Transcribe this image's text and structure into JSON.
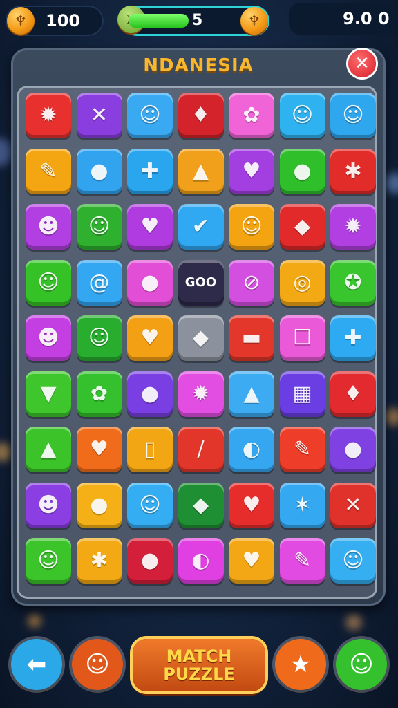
{
  "hud": {
    "coins": "100",
    "level": "5",
    "level_progress": 0.45,
    "timer": "9.0 0"
  },
  "panel": {
    "title": "NDANESIA",
    "close_glyph": "✕"
  },
  "board": {
    "tiles": [
      [
        {
          "c": "#e8312f",
          "g": "✹"
        },
        {
          "c": "#8a3ee0",
          "g": "✕"
        },
        {
          "c": "#39a9f2",
          "g": "☺"
        },
        {
          "c": "#d4232a",
          "g": "♦"
        },
        {
          "c": "#f064d8",
          "g": "✿"
        },
        {
          "c": "#2fb3f0",
          "g": "☺"
        },
        {
          "c": "#2fa7ef",
          "g": "☺"
        }
      ],
      [
        {
          "c": "#f4a512",
          "g": "✎"
        },
        {
          "c": "#32a3ef",
          "g": "●"
        },
        {
          "c": "#2aa6ef",
          "g": "✚"
        },
        {
          "c": "#f0a01a",
          "g": "▲"
        },
        {
          "c": "#a33ee0",
          "g": "♥"
        },
        {
          "c": "#2fbf2b",
          "g": "●"
        },
        {
          "c": "#e22c2a",
          "g": "✱"
        }
      ],
      [
        {
          "c": "#b23fe2",
          "g": "☻"
        },
        {
          "c": "#2fb02f",
          "g": "☺"
        },
        {
          "c": "#b03be0",
          "g": "♥"
        },
        {
          "c": "#30a8f2",
          "g": "✔"
        },
        {
          "c": "#f4a311",
          "g": "☺"
        },
        {
          "c": "#e22a2a",
          "g": "◆"
        },
        {
          "c": "#b23fe2",
          "g": "✹"
        }
      ],
      [
        {
          "c": "#34c226",
          "g": "☺"
        },
        {
          "c": "#33a7f2",
          "g": "@"
        },
        {
          "c": "#e24fd6",
          "g": "●"
        },
        {
          "c": "#2d2a4a",
          "g": "GOO",
          "text": true
        },
        {
          "c": "#d34fe0",
          "g": "⊘"
        },
        {
          "c": "#f3a914",
          "g": "◎"
        },
        {
          "c": "#39c52e",
          "g": "✪"
        }
      ],
      [
        {
          "c": "#c43fe2",
          "g": "☻"
        },
        {
          "c": "#29ad2f",
          "g": "☺"
        },
        {
          "c": "#f4a014",
          "g": "♥"
        },
        {
          "c": "#8b929e",
          "g": "◆"
        },
        {
          "c": "#e2372a",
          "g": "▬"
        },
        {
          "c": "#ea5ad8",
          "g": "☐"
        },
        {
          "c": "#2eaaf2",
          "g": "✚"
        }
      ],
      [
        {
          "c": "#3ec62c",
          "g": "▼"
        },
        {
          "c": "#35c12d",
          "g": "✿"
        },
        {
          "c": "#7a3fe2",
          "g": "●"
        },
        {
          "c": "#e24ee2",
          "g": "✹"
        },
        {
          "c": "#3cabf2",
          "g": "▲"
        },
        {
          "c": "#6a3ee2",
          "g": "▦"
        },
        {
          "c": "#e22a2f",
          "g": "♦"
        }
      ],
      [
        {
          "c": "#3cc32a",
          "g": "▲"
        },
        {
          "c": "#f16c1a",
          "g": "♥"
        },
        {
          "c": "#f3a614",
          "g": "▯"
        },
        {
          "c": "#e2362a",
          "g": "∕"
        },
        {
          "c": "#35a6f0",
          "g": "◐"
        },
        {
          "c": "#ee3d28",
          "g": "✎"
        },
        {
          "c": "#7f41e2",
          "g": "●"
        }
      ],
      [
        {
          "c": "#8b3ee2",
          "g": "☻"
        },
        {
          "c": "#f4b016",
          "g": "●"
        },
        {
          "c": "#35adf2",
          "g": "☺"
        },
        {
          "c": "#1f8f34",
          "g": "◆"
        },
        {
          "c": "#e62d2c",
          "g": "♥"
        },
        {
          "c": "#35a8f2",
          "g": "✶"
        },
        {
          "c": "#e0312a",
          "g": "✕"
        }
      ],
      [
        {
          "c": "#3cc52a",
          "g": "☺"
        },
        {
          "c": "#f2a914",
          "g": "✱"
        },
        {
          "c": "#d41f3a",
          "g": "●"
        },
        {
          "c": "#e03fe2",
          "g": "◐"
        },
        {
          "c": "#f3a714",
          "g": "♥"
        },
        {
          "c": "#e24be2",
          "g": "✎"
        },
        {
          "c": "#35aef2",
          "g": "☺"
        }
      ]
    ]
  },
  "controls": {
    "back_glyph": "⬅",
    "character_glyph": "☺",
    "match_line1": "MATCH",
    "match_line2": "PUZZLE",
    "star_glyph": "★",
    "hint_glyph": "☺"
  },
  "colors": {
    "back": "#2aa8e8",
    "character": "#e2581a",
    "star": "#ef6a1a",
    "hint": "#35c12d"
  }
}
